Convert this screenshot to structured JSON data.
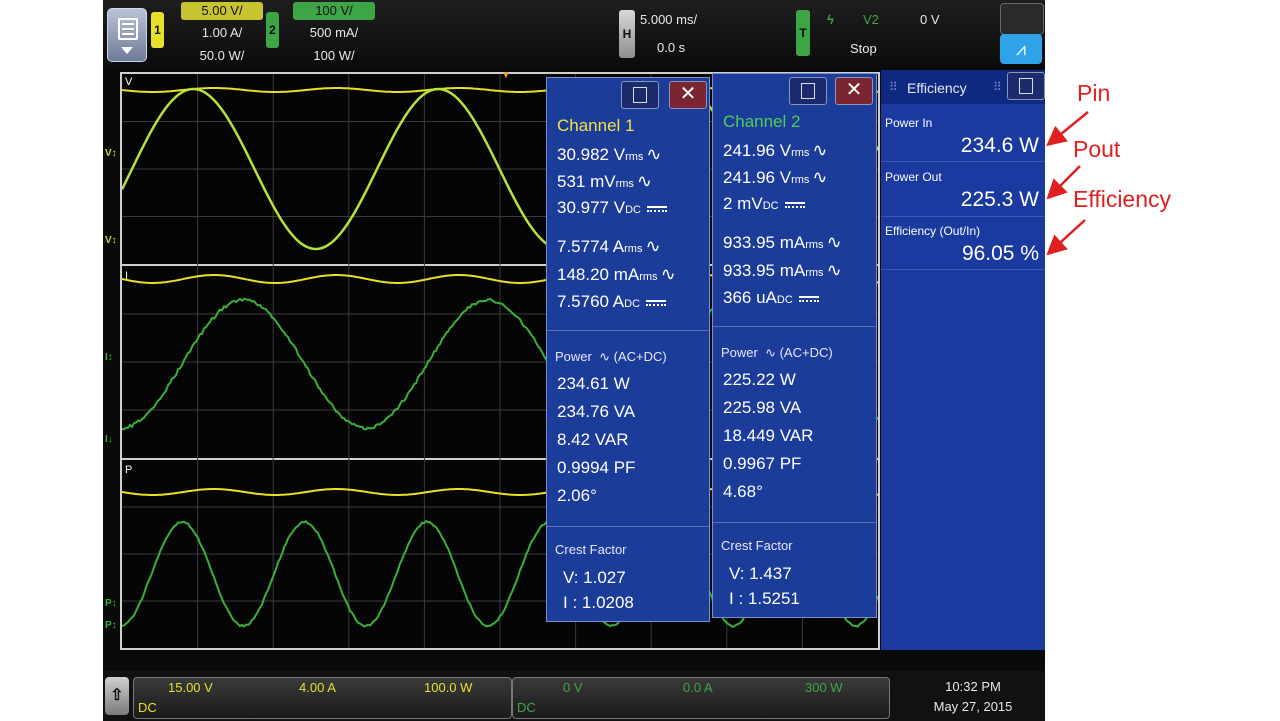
{
  "top_bar": {
    "ch1": {
      "number": "1",
      "scale_top": "5.00 V/",
      "scale_mid": "1.00 A/",
      "scale_bot": "50.0 W/"
    },
    "ch2": {
      "number": "2",
      "scale_top": "100 V/",
      "scale_mid": "500 mA/",
      "scale_bot": "100 W/"
    },
    "horizontal": {
      "tag": "H",
      "timebase": "5.000 ms/",
      "delay": "0.0 s"
    },
    "trigger": {
      "tag": "T",
      "source": "V2",
      "level": "0 V",
      "status": "Stop"
    }
  },
  "waveform_labels": {
    "voltage": "V",
    "current": "I",
    "power": "P"
  },
  "channel1": {
    "title": "Channel 1",
    "v_rms": "30.982 V",
    "v_rms_sub": "rms",
    "v_ac": "531 mV",
    "v_ac_sub": "rms",
    "v_dc": "30.977 V",
    "v_dc_sub": "DC",
    "i_rms": "7.5774 A",
    "i_rms_sub": "rms",
    "i_ac": "148.20 mA",
    "i_ac_sub": "rms",
    "i_dc": "7.5760 A",
    "i_dc_sub": "DC",
    "power_label": "Power",
    "power_mode": "(AC+DC)",
    "real": "234.61 W",
    "apparent": "234.76 VA",
    "reactive": "8.42 VAR",
    "pf": "0.9994 PF",
    "phase": "2.06°",
    "crest_label": "Crest Factor",
    "crest_v": "V:  1.027",
    "crest_i": "I :  1.0208"
  },
  "channel2": {
    "title": "Channel 2",
    "v_rms": "241.96 V",
    "v_rms_sub": "rms",
    "v_ac": "241.96 V",
    "v_ac_sub": "rms",
    "v_dc": "2 mV",
    "v_dc_sub": "DC",
    "i_rms": "933.95 mA",
    "i_rms_sub": "rms",
    "i_ac": "933.95 mA",
    "i_ac_sub": "rms",
    "i_dc": "366 uA",
    "i_dc_sub": "DC",
    "power_label": "Power",
    "power_mode": "(AC+DC)",
    "real": "225.22 W",
    "apparent": "225.98 VA",
    "reactive": "18.449 VAR",
    "pf": "0.9967 PF",
    "phase": "4.68°",
    "crest_label": "Crest Factor",
    "crest_v": "V:  1.437",
    "crest_i": "I :  1.5251"
  },
  "efficiency_panel": {
    "title": "Efficiency",
    "power_in_label": "Power In",
    "power_in_value": "234.6 W",
    "power_out_label": "Power Out",
    "power_out_value": "225.3 W",
    "efficiency_label": "Efficiency (Out/In)",
    "efficiency_value": "96.05 %"
  },
  "bottom_bar": {
    "left": {
      "v": "15.00 V",
      "a": "4.00 A",
      "w": "100.0 W",
      "coupling": "DC"
    },
    "right": {
      "v": "0 V",
      "a": "0.0 A",
      "w": "300 W",
      "coupling": "DC"
    },
    "time": "10:32 PM",
    "date": "May 27, 2015"
  },
  "annotations": {
    "pin": "Pin",
    "pout": "Pout",
    "efficiency": "Efficiency"
  },
  "colors": {
    "ch1": "#e6e02a",
    "ch2": "#2fae3b",
    "voltage_trace": "#b6e23a",
    "current_trace": "#3cae3a",
    "panel": "#1c3c9a",
    "annotation": "#e02020"
  }
}
